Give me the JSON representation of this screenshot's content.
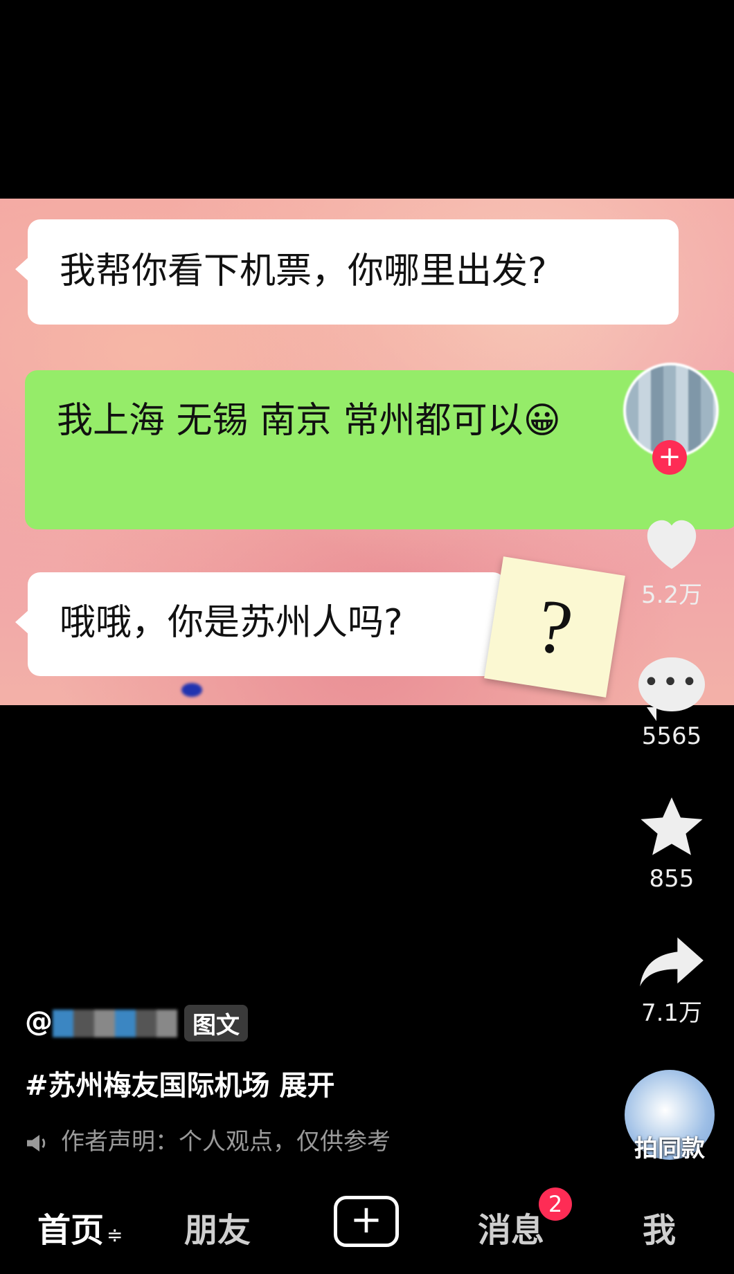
{
  "chat": {
    "msg1": "我帮你看下机票，你哪里出发?",
    "msg2": "我上海 无锡 南京 常州都可以😀",
    "msg3": "哦哦，你是苏州人吗?",
    "sticky_note": "?"
  },
  "rail": {
    "likes": "5.2万",
    "comments": "5565",
    "favorites": "855",
    "shares": "7.1万",
    "sound_label": "拍同款"
  },
  "post": {
    "author_prefix": "@",
    "type_tag": "图文",
    "caption": "#苏州梅友国际机场  展开",
    "declaration": "作者声明：个人观点，仅供参考"
  },
  "nav": {
    "home": "首页",
    "home_suffix": "≑",
    "friends": "朋友",
    "plus": "+",
    "messages": "消息",
    "message_badge": "2",
    "me": "我"
  },
  "colors": {
    "green_bubble": "#95ec69",
    "badge_red": "#fe2c55"
  }
}
